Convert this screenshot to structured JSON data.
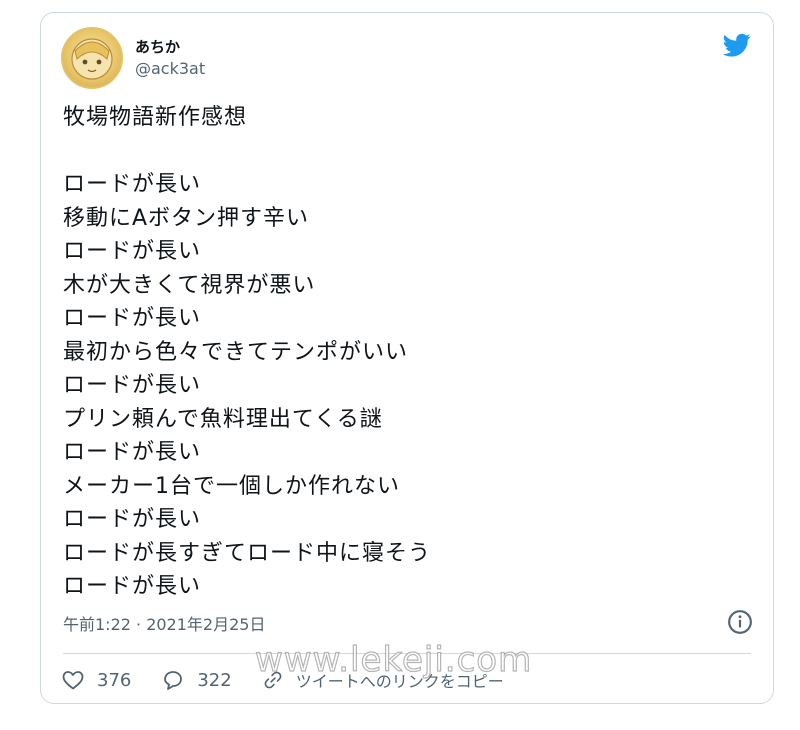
{
  "tweet": {
    "display_name": "あちか",
    "handle": "@ack3at",
    "lines": [
      "牧場物語新作感想",
      "",
      "ロードが長い",
      "移動にAボタン押す辛い",
      "ロードが長い",
      "木が大きくて視界が悪い",
      "ロードが長い",
      "最初から色々できてテンポがいい",
      "ロードが長い",
      "プリン頼んで魚料理出てくる謎",
      "ロードが長い",
      "メーカー1台で一個しか作れない",
      "ロードが長い",
      "ロードが長すぎてロード中に寝そう",
      "ロードが長い"
    ],
    "timestamp": "午前1:22 · 2021年2月25日",
    "likes": "376",
    "replies": "322",
    "copy_link_label": "ツイートへのリンクをコピー"
  },
  "watermark": "www.lekeji.com",
  "colors": {
    "twitter_blue": "#1d9bf0",
    "secondary_text": "#536471",
    "border": "#cfd9de"
  },
  "icons": {
    "brand": "twitter-bird-icon",
    "info": "info-icon",
    "like": "heart-icon",
    "reply": "reply-bubble-icon",
    "link": "link-icon"
  }
}
